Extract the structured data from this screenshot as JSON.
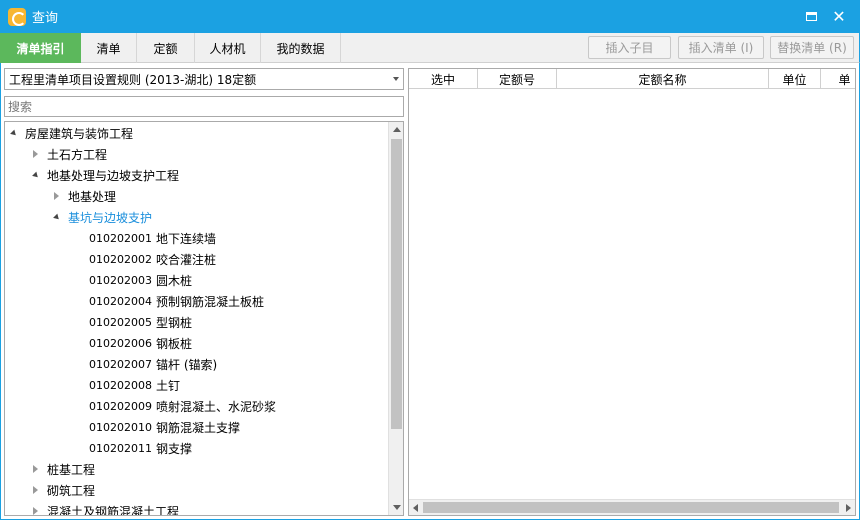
{
  "window": {
    "title": "查询",
    "maximize_icon": "maximize-icon",
    "close_icon": "close-icon",
    "close_glyph": "✕"
  },
  "tabs": [
    {
      "label": "清单指引",
      "active": true
    },
    {
      "label": "清单"
    },
    {
      "label": "定额"
    },
    {
      "label": "人材机"
    },
    {
      "label": "我的数据"
    }
  ],
  "toolbar": {
    "insert_sub_label": "插入子目",
    "insert_list_label": "插入清单 (I)",
    "replace_list_label": "替换清单 (R)"
  },
  "left_panel": {
    "spec_selected": "工程里清单项目设置规则 (2013-湖北) 18定额",
    "search_placeholder": "搜索",
    "tree": [
      {
        "label": "房屋建筑与装饰工程",
        "state": "open"
      },
      {
        "label": "土石方工程",
        "state": "closed"
      },
      {
        "label": "地基处理与边坡支护工程",
        "state": "open"
      },
      {
        "label": "地基处理",
        "state": "closed"
      },
      {
        "label": "基坑与边坡支护",
        "state": "open",
        "selected": true
      },
      {
        "code": "010202001",
        "label": "地下连续墙"
      },
      {
        "code": "010202002",
        "label": "咬合灌注桩"
      },
      {
        "code": "010202003",
        "label": "圆木桩"
      },
      {
        "code": "010202004",
        "label": "预制钢筋混凝土板桩"
      },
      {
        "code": "010202005",
        "label": "型钢桩"
      },
      {
        "code": "010202006",
        "label": "钢板桩"
      },
      {
        "code": "010202007",
        "label": "锚杆 (锚索)"
      },
      {
        "code": "010202008",
        "label": "土钉"
      },
      {
        "code": "010202009",
        "label": "喷射混凝土、水泥砂浆"
      },
      {
        "code": "010202010",
        "label": "钢筋混凝土支撑"
      },
      {
        "code": "010202011",
        "label": "钢支撑"
      },
      {
        "label": "桩基工程",
        "state": "closed"
      },
      {
        "label": "砌筑工程",
        "state": "closed"
      },
      {
        "label": "混凝土及钢筋混凝土工程",
        "state": "closed"
      }
    ]
  },
  "grid": {
    "columns": [
      "选中",
      "定额号",
      "定额名称",
      "单位",
      "单"
    ]
  },
  "colors": {
    "titlebar": "#1ba1e2",
    "active_tab": "#5cb85c",
    "selected_node": "#1b8fdc"
  }
}
